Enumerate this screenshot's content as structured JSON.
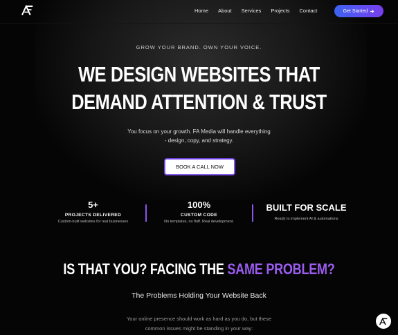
{
  "nav": {
    "links": [
      "Home",
      "About",
      "Services",
      "Projects",
      "Contact"
    ],
    "cta_label": "Get Started",
    "cta_icon": "arrow-right-icon"
  },
  "hero": {
    "eyebrow": "GROW YOUR BRAND. OWN YOUR VOICE.",
    "headline_line1": "WE DESIGN WEBSITES THAT",
    "headline_line2": "DEMAND ATTENTION & TRUST",
    "sub_line1": "You focus on your growth. FA Media will handle everything",
    "sub_line2": "- design, copy, and strategy.",
    "button_label": "BOOK A CALL NOW"
  },
  "stats": [
    {
      "value": "5+",
      "label": "PROJECTS DELIVERED",
      "desc": "Custom-built websites for real businesses"
    },
    {
      "value": "100%",
      "label": "CUSTOM CODE",
      "desc": "No templates, no fluff. Real development."
    },
    {
      "value": "BUILT FOR SCALE",
      "label": "",
      "desc": "Ready to implement AI & automations"
    }
  ],
  "problem": {
    "title_plain": "IS THAT YOU? FACING THE ",
    "title_accent": "SAME PROBLEM?",
    "subtitle": "The Problems Holding Your Website Back",
    "text_line1": "Your online presence should work as hard as you do, but these",
    "text_line2": "common issues might be standing in your way:"
  },
  "colors": {
    "accent": "#9b5cf0",
    "cta_gradient_start": "#3b63f0",
    "cta_gradient_end": "#7a3ef0",
    "background": "#050505"
  }
}
